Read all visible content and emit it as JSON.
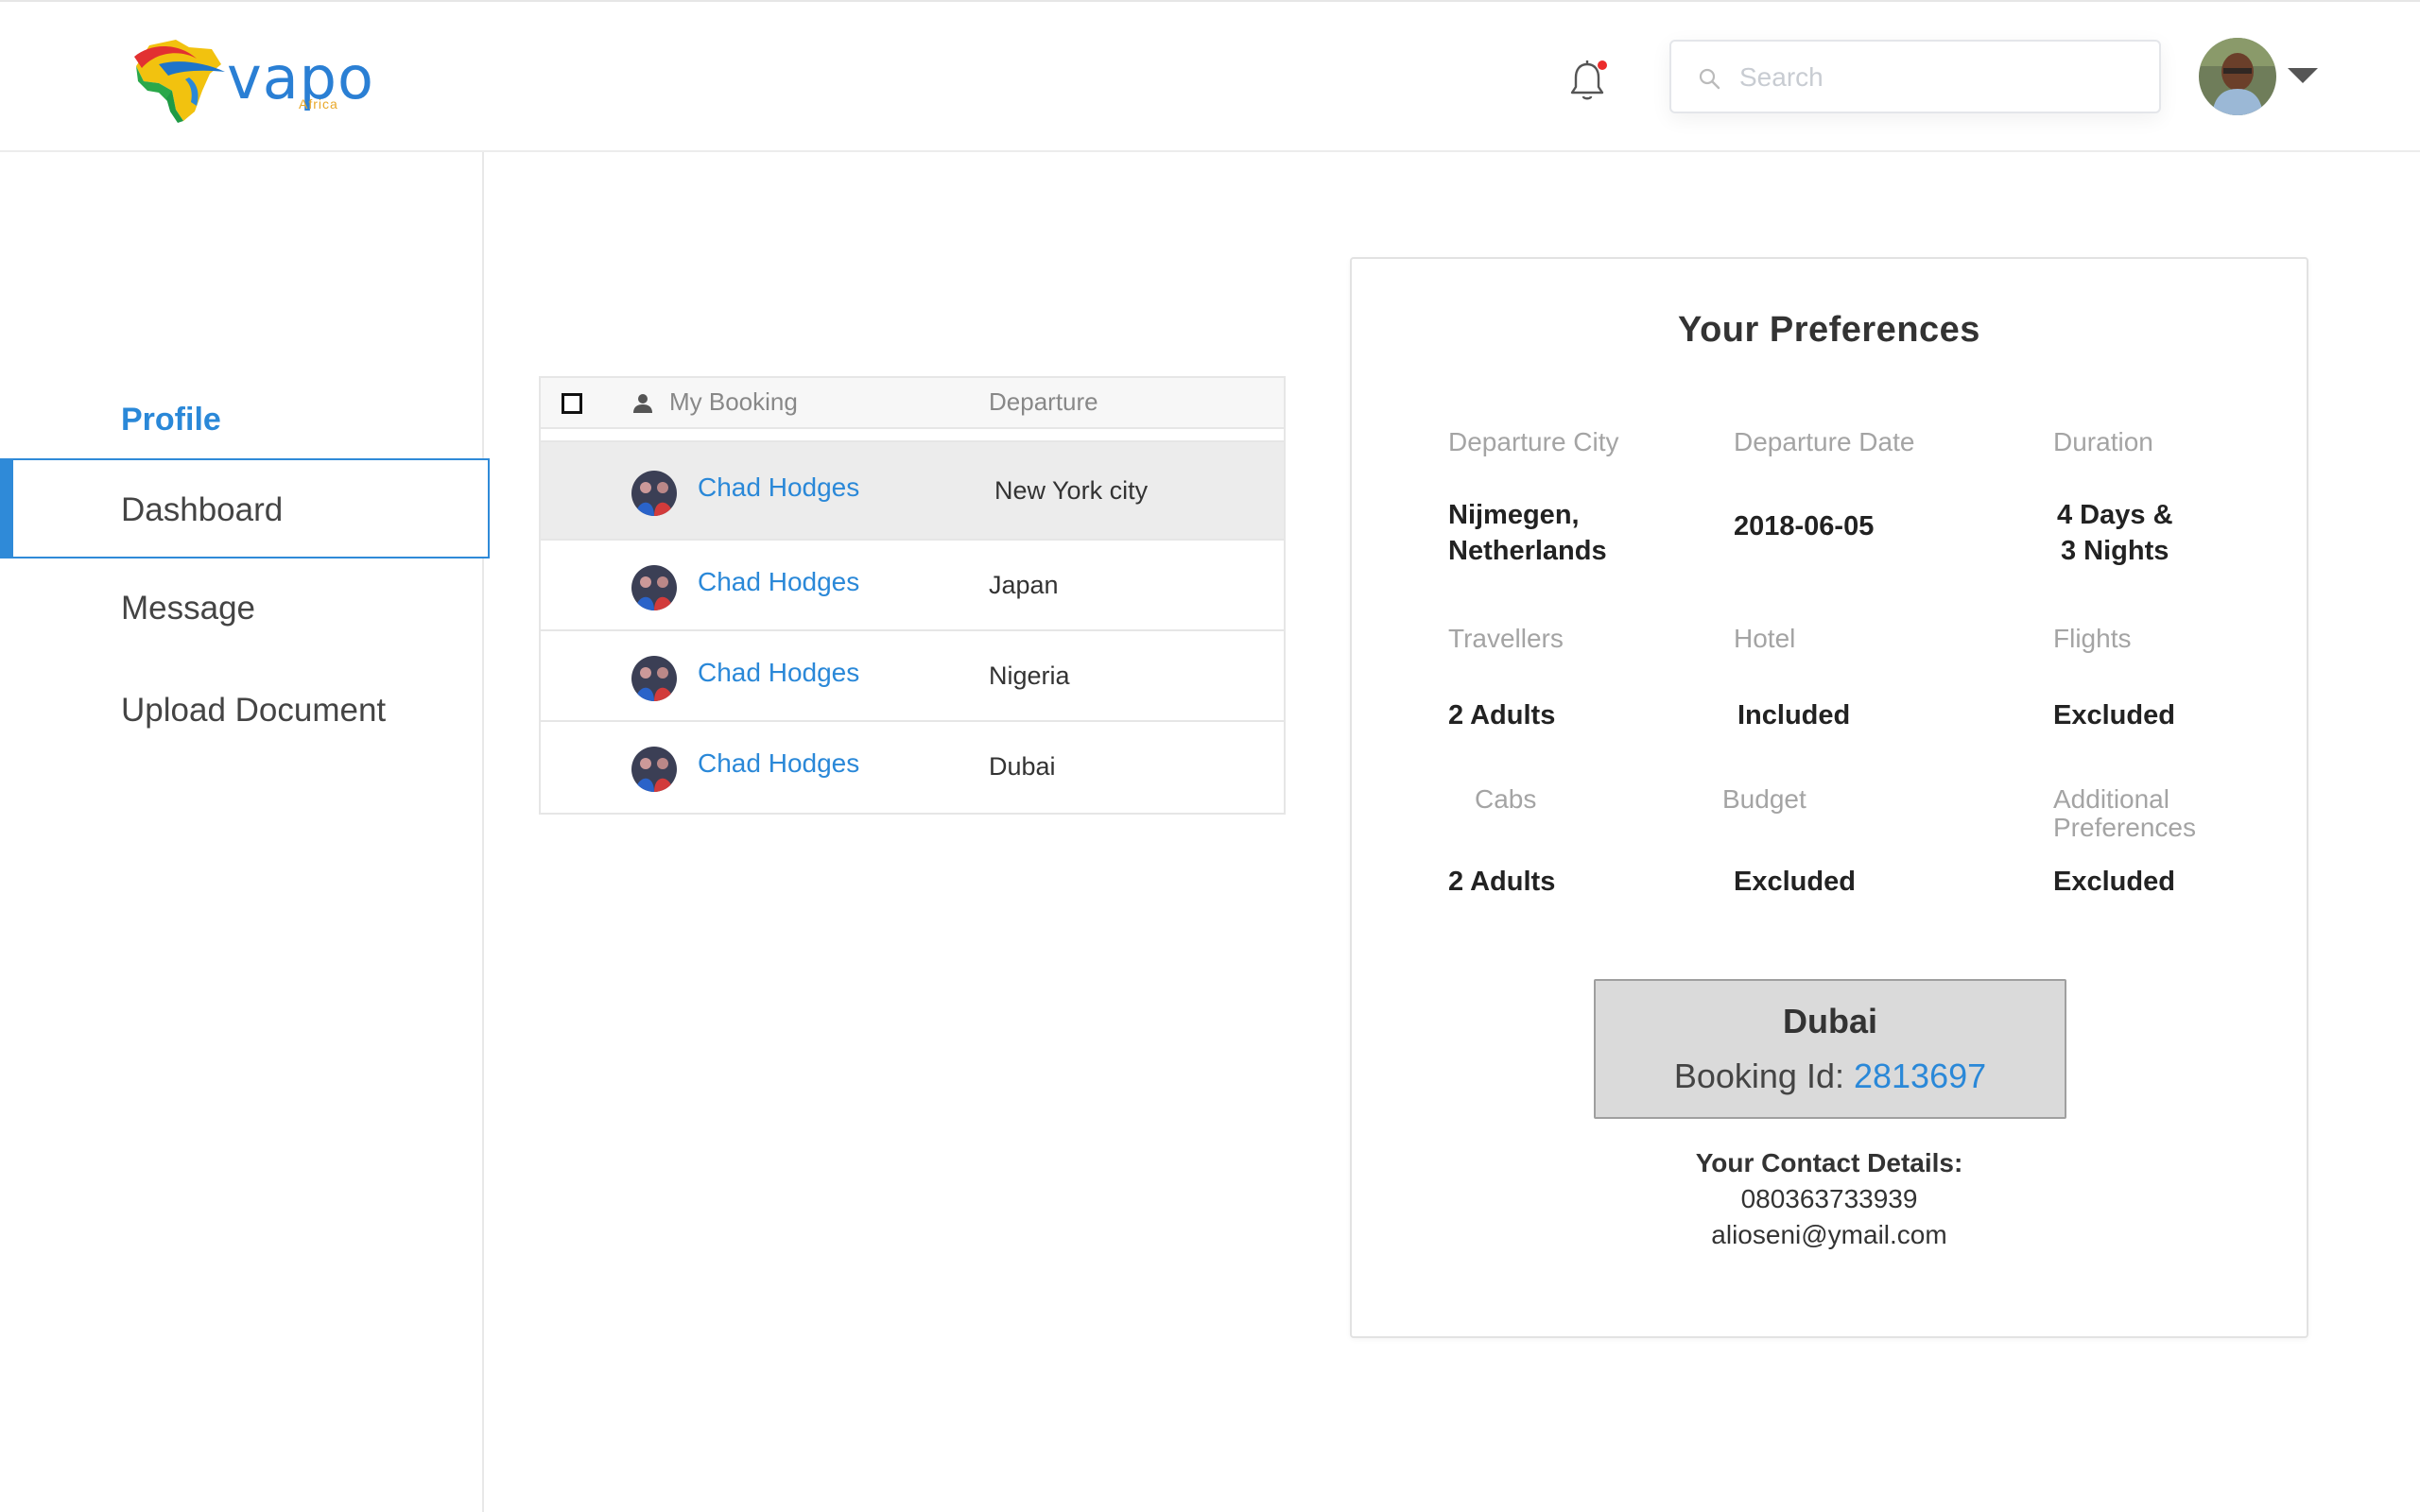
{
  "header": {
    "logo_word": "vapo",
    "logo_sub": "Africa",
    "search_placeholder": "Search",
    "colors": {
      "accent": "#2a88d8",
      "notification_dot": "#ec2b2b"
    }
  },
  "sidebar": {
    "title": "Profile",
    "items": [
      {
        "label": "Dashboard",
        "active": true
      },
      {
        "label": "Message",
        "active": false
      },
      {
        "label": "Upload Document",
        "active": false
      }
    ]
  },
  "bookings": {
    "columns": {
      "booking": "My Booking",
      "departure": "Departure"
    },
    "rows": [
      {
        "name": "Chad Hodges",
        "departure": "New York city",
        "selected": true
      },
      {
        "name": "Chad Hodges",
        "departure": "Japan",
        "selected": false
      },
      {
        "name": "Chad Hodges",
        "departure": "Nigeria",
        "selected": false
      },
      {
        "name": "Chad Hodges",
        "departure": "Dubai",
        "selected": false
      }
    ]
  },
  "preferences": {
    "title": "Your Preferences",
    "departure_city": {
      "label": "Departure City",
      "value_line1": "Nijmegen,",
      "value_line2": "Netherlands"
    },
    "departure_date": {
      "label": "Departure Date",
      "value": "2018-06-05"
    },
    "duration": {
      "label": "Duration",
      "value_line1": "4 Days &",
      "value_line2": "3 Nights"
    },
    "travellers": {
      "label": "Travellers",
      "value": "2 Adults"
    },
    "hotel": {
      "label": "Hotel",
      "value": "Included"
    },
    "flights": {
      "label": "Flights",
      "value": "Excluded"
    },
    "cabs": {
      "label": "Cabs",
      "value": "2 Adults"
    },
    "budget": {
      "label": "Budget",
      "value": "Excluded"
    },
    "additional": {
      "label_line1": "Additional",
      "label_line2": "Preferences",
      "value": "Excluded"
    },
    "destination": {
      "city": "Dubai",
      "booking_label": "Booking Id:",
      "booking_id": "2813697"
    },
    "contact": {
      "heading": "Your Contact Details:",
      "phone": "080363733939",
      "email": "alioseni@ymail.com"
    }
  }
}
